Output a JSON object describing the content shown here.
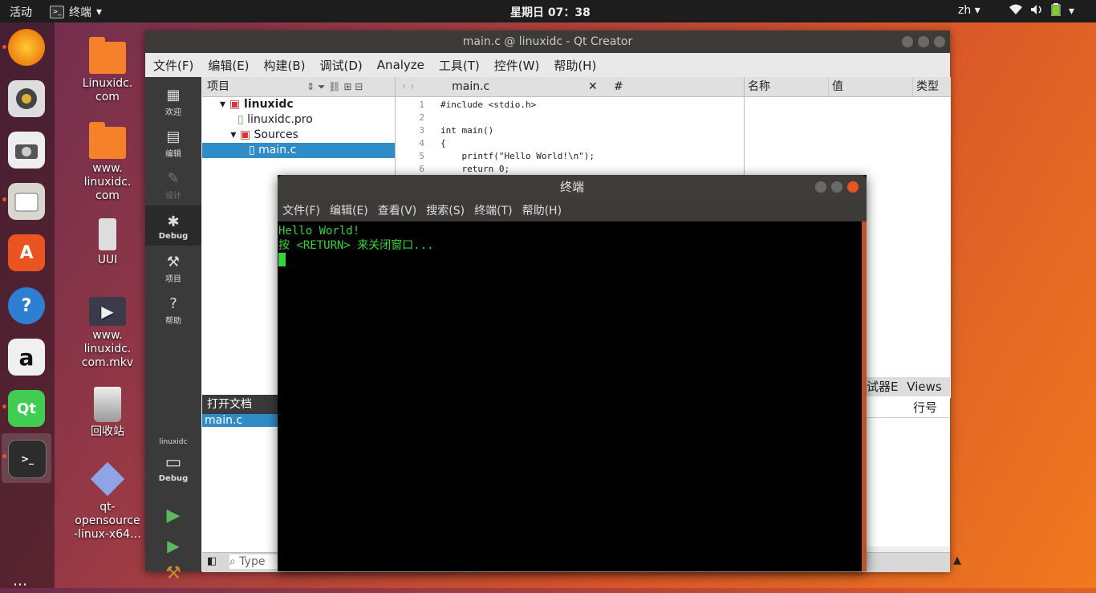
{
  "topbar": {
    "activities": "活动",
    "app": "终端",
    "clock": "星期日 07：38",
    "lang": "zh"
  },
  "dock": {
    "qt_label": "Qt",
    "amazon_label": "a",
    "help_label": "?",
    "store_label": "A"
  },
  "desktop": {
    "items": [
      {
        "label": "Linuxidc.\ncom"
      },
      {
        "label": "www.\nlinuxidc.\ncom"
      },
      {
        "label": "UUI"
      },
      {
        "label": "www.\nlinuxidc.\ncom.mkv"
      },
      {
        "label": "回收站"
      },
      {
        "label": "qt-\nopensource\n-linux-x64…"
      }
    ]
  },
  "qt": {
    "title": "main.c @ linuxidc - Qt Creator",
    "menu": [
      "文件(F)",
      "编辑(E)",
      "构建(B)",
      "调试(D)",
      "Analyze",
      "工具(T)",
      "控件(W)",
      "帮助(H)"
    ],
    "modes": [
      {
        "label": "欢迎"
      },
      {
        "label": "编辑"
      },
      {
        "label": "设计"
      },
      {
        "label": "Debug"
      },
      {
        "label": "项目"
      },
      {
        "label": "帮助"
      }
    ],
    "kit": {
      "project": "linuxidc",
      "build": "Debug"
    },
    "project_pane": {
      "header": "项目",
      "tree": [
        "linuxidc",
        "linuxidc.pro",
        "Sources",
        "main.c"
      ]
    },
    "editor": {
      "file": "main.c",
      "hash": "#",
      "lines": [
        {
          "n": "1",
          "code": "#include <stdio.h>"
        },
        {
          "n": "2",
          "code": ""
        },
        {
          "n": "3",
          "code": "int main()"
        },
        {
          "n": "4",
          "code": "{"
        },
        {
          "n": "5",
          "code": "    printf(\"Hello World!\\n\");"
        },
        {
          "n": "6",
          "code": "    return 0;"
        }
      ]
    },
    "var_pane": {
      "col_name": "名称",
      "col_value": "值",
      "col_type": "类型",
      "views": "Views",
      "frag": "试器E",
      "col_line": "行号"
    },
    "open_docs": {
      "header": "打开文档",
      "item": "main.c"
    },
    "search_placeholder": "Type"
  },
  "terminal": {
    "title": "终端",
    "menu": [
      "文件(F)",
      "编辑(E)",
      "查看(V)",
      "搜索(S)",
      "终端(T)",
      "帮助(H)"
    ],
    "output": [
      "Hello World!",
      "按 <RETURN> 来关闭窗口..."
    ]
  }
}
